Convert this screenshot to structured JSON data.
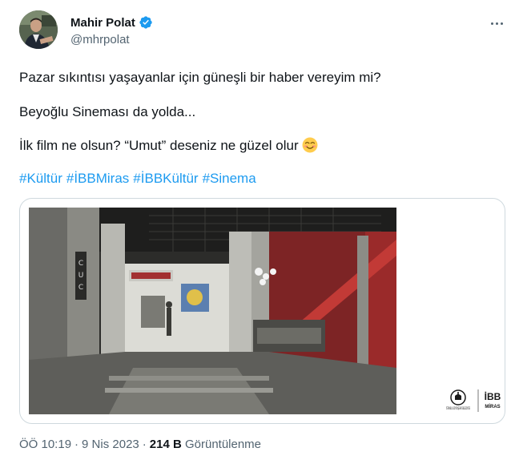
{
  "author": {
    "display_name": "Mahir Polat",
    "handle": "@mhrpolat",
    "verified": true,
    "avatar_icon": "avatar-photo"
  },
  "tweet": {
    "lines": [
      "Pazar sıkıntısı yaşayanlar için güneşli bir haber vereyim mi?",
      "Beyoğlu Sineması da yolda...",
      "İlk film ne olsun? “Umut” deseniz ne güzel olur"
    ],
    "emoji": "smiling-face-emoji",
    "hashtags": [
      "#Kültür",
      "#İBBMiras",
      "#İBBKültür",
      "#Sinema"
    ]
  },
  "media": {
    "image": "cinema-lobby-rendering",
    "logo_text": "İBB",
    "logo_subtext": "MİRAS",
    "seal_text": "İSTANBUL BÜYÜKŞEHİR BELEDİYESİ"
  },
  "meta": {
    "time": "ÖÖ 10:19",
    "date": "9 Nis 2023",
    "views_count": "214 B",
    "views_label": "Görüntülenme",
    "separator": "·"
  },
  "colors": {
    "link": "#1d9bf0",
    "secondary_text": "#536471",
    "border": "#cfd9de",
    "verified_badge": "#1d9bf0"
  }
}
